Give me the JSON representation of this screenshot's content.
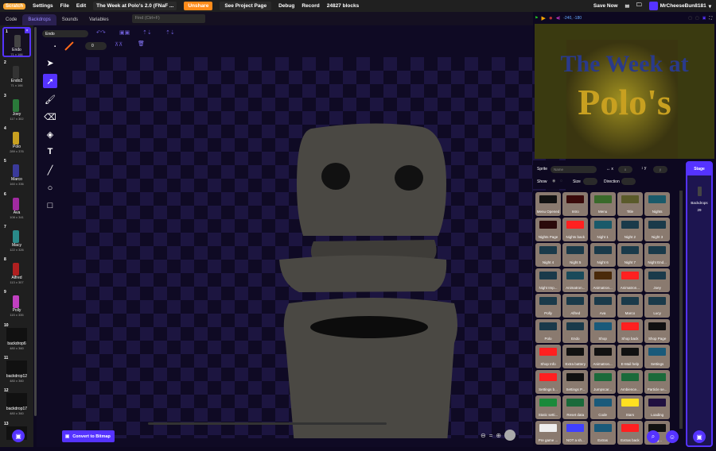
{
  "menubar": {
    "logo": "Scratch",
    "settings": "Settings",
    "file": "File",
    "edit": "Edit",
    "project_title": "The Week at Polo's 2.0 (FNaF ...",
    "unshare": "Unshare",
    "see_project": "See Project Page",
    "debug": "Debug",
    "record": "Record",
    "blocks": "24827 blocks",
    "save_now": "Save Now",
    "username": "MrCheeseBun8181"
  },
  "tabs": {
    "code": "Code",
    "backdrops": "Backdrops",
    "sounds": "Sounds",
    "variables": "Variables",
    "find_placeholder": "Find (Ctrl+F)"
  },
  "costumes": [
    {
      "num": "1",
      "name": "Endo",
      "size": "71 x 166",
      "color": "#444"
    },
    {
      "num": "2",
      "name": "Endo2",
      "size": "71 x 166",
      "color": "#333"
    },
    {
      "num": "3",
      "name": "Joey",
      "size": "117 x 302",
      "color": "#2a7a3a"
    },
    {
      "num": "4",
      "name": "Polo",
      "size": "289 x 376",
      "color": "#c8a020"
    },
    {
      "num": "5",
      "name": "Marco",
      "size": "160 x 336",
      "color": "#3a3a9a"
    },
    {
      "num": "6",
      "name": "Ava",
      "size": "108 x 341",
      "color": "#a02aa0"
    },
    {
      "num": "7",
      "name": "Macy",
      "size": "122 x 326",
      "color": "#2a8a8a"
    },
    {
      "num": "8",
      "name": "Alfred",
      "size": "113 x 307",
      "color": "#b02020"
    },
    {
      "num": "9",
      "name": "Polly",
      "size": "115 x 335",
      "color": "#c040c0"
    },
    {
      "num": "10",
      "name": "backdrop6",
      "size": "480 x 360",
      "color": "bd"
    },
    {
      "num": "11",
      "name": "backdrop12",
      "size": "480 x 360",
      "color": "bd"
    },
    {
      "num": "12",
      "name": "backdrop17",
      "size": "480 x 360",
      "color": "bd"
    },
    {
      "num": "13",
      "name": "",
      "size": "",
      "color": "bd"
    }
  ],
  "editor": {
    "costume_name": "Endo",
    "outline_width": "0",
    "convert_button": "Convert to Bitmap",
    "zoom_reset": "="
  },
  "stage": {
    "coords": "-240, -180",
    "title_line1": "The Week at",
    "title_line2": "Polo's"
  },
  "sprite_info": {
    "sprite_label": "Sprite",
    "name_placeholder": "Name",
    "x_label": "x",
    "y_label": "y",
    "x_placeholder": "x",
    "y_placeholder": "y",
    "show_label": "Show",
    "size_label": "Size",
    "direction_label": "Direction"
  },
  "stage_panel": {
    "title": "Stage",
    "backdrops_label": "Backdrops",
    "backdrops_count": "29"
  },
  "sprites": [
    {
      "name": "Menu Opened",
      "img": "#111"
    },
    {
      "name": "Intro",
      "img": "#3a0a0a"
    },
    {
      "name": "Menu",
      "img": "#3a6a2a"
    },
    {
      "name": "Title",
      "img": "#5a5a2a"
    },
    {
      "name": "Nights",
      "img": "#1a5a6a"
    },
    {
      "name": "Nights Page",
      "img": "#2a0a0a"
    },
    {
      "name": "Nights back",
      "img": "#ff2020"
    },
    {
      "name": "Night 1",
      "img": "#1a5a6a"
    },
    {
      "name": "Night 2",
      "img": "#1a3a4a"
    },
    {
      "name": "Night 3",
      "img": "#1a3a4a"
    },
    {
      "name": "Night 4",
      "img": "#1a3a4a"
    },
    {
      "name": "Night 5",
      "img": "#1a3a4a"
    },
    {
      "name": "Night 6",
      "img": "#1a3a4a"
    },
    {
      "name": "Night 7",
      "img": "#1a3a4a"
    },
    {
      "name": "Night End...",
      "img": "#1a3a4a"
    },
    {
      "name": "Night Imp...",
      "img": "#1a3a4a"
    },
    {
      "name": "Animatron...",
      "img": "#1a4a5a"
    },
    {
      "name": "Animatron...",
      "img": "#4a2a0a"
    },
    {
      "name": "Animatron...",
      "img": "#ff2020"
    },
    {
      "name": "Joey",
      "img": "#1a3a4a"
    },
    {
      "name": "Polly",
      "img": "#1a3a4a"
    },
    {
      "name": "Alfred",
      "img": "#1a3a4a"
    },
    {
      "name": "Ava",
      "img": "#1a3a4a"
    },
    {
      "name": "Marco",
      "img": "#1a3a4a"
    },
    {
      "name": "Lucy",
      "img": "#1a3a4a"
    },
    {
      "name": "Polo",
      "img": "#1a3a4a"
    },
    {
      "name": "Endo",
      "img": "#1a3a4a"
    },
    {
      "name": "Shop",
      "img": "#1a5a7a"
    },
    {
      "name": "Shop back",
      "img": "#ff2020"
    },
    {
      "name": "Shop Page",
      "img": "#111"
    },
    {
      "name": "Shop Info",
      "img": "#ff2020"
    },
    {
      "name": "Extra battery",
      "img": "#111"
    },
    {
      "name": "Animatron...",
      "img": "#111"
    },
    {
      "name": "E-Mail help",
      "img": "#111"
    },
    {
      "name": "Settings",
      "img": "#1a5a7a"
    },
    {
      "name": "Settings b...",
      "img": "#ff2020"
    },
    {
      "name": "Settings P...",
      "img": "#111"
    },
    {
      "name": "Jumpscar...",
      "img": "#1a6a3a"
    },
    {
      "name": "Ambience...",
      "img": "#1a6a3a"
    },
    {
      "name": "Particle se...",
      "img": "#1a6a3a"
    },
    {
      "name": "Static setti...",
      "img": "#1a8a3a"
    },
    {
      "name": "Reset data",
      "img": "#1a6a3a"
    },
    {
      "name": "Code",
      "img": "#1a5a7a"
    },
    {
      "name": "Stars",
      "img": "#ffe020"
    },
    {
      "name": "Loading",
      "img": "#201040"
    },
    {
      "name": "Pre game ...",
      "img": "#eee"
    },
    {
      "name": "NOT a sh...",
      "img": "#4040ff"
    },
    {
      "name": "Extras",
      "img": "#1a5a7a"
    },
    {
      "name": "Extras back",
      "img": "#ff2020"
    },
    {
      "name": "Pag...",
      "img": "#111"
    }
  ],
  "colors": {
    "accent": "#5533ff",
    "unshare": "#ff8c1a",
    "menubar": "#202020"
  }
}
